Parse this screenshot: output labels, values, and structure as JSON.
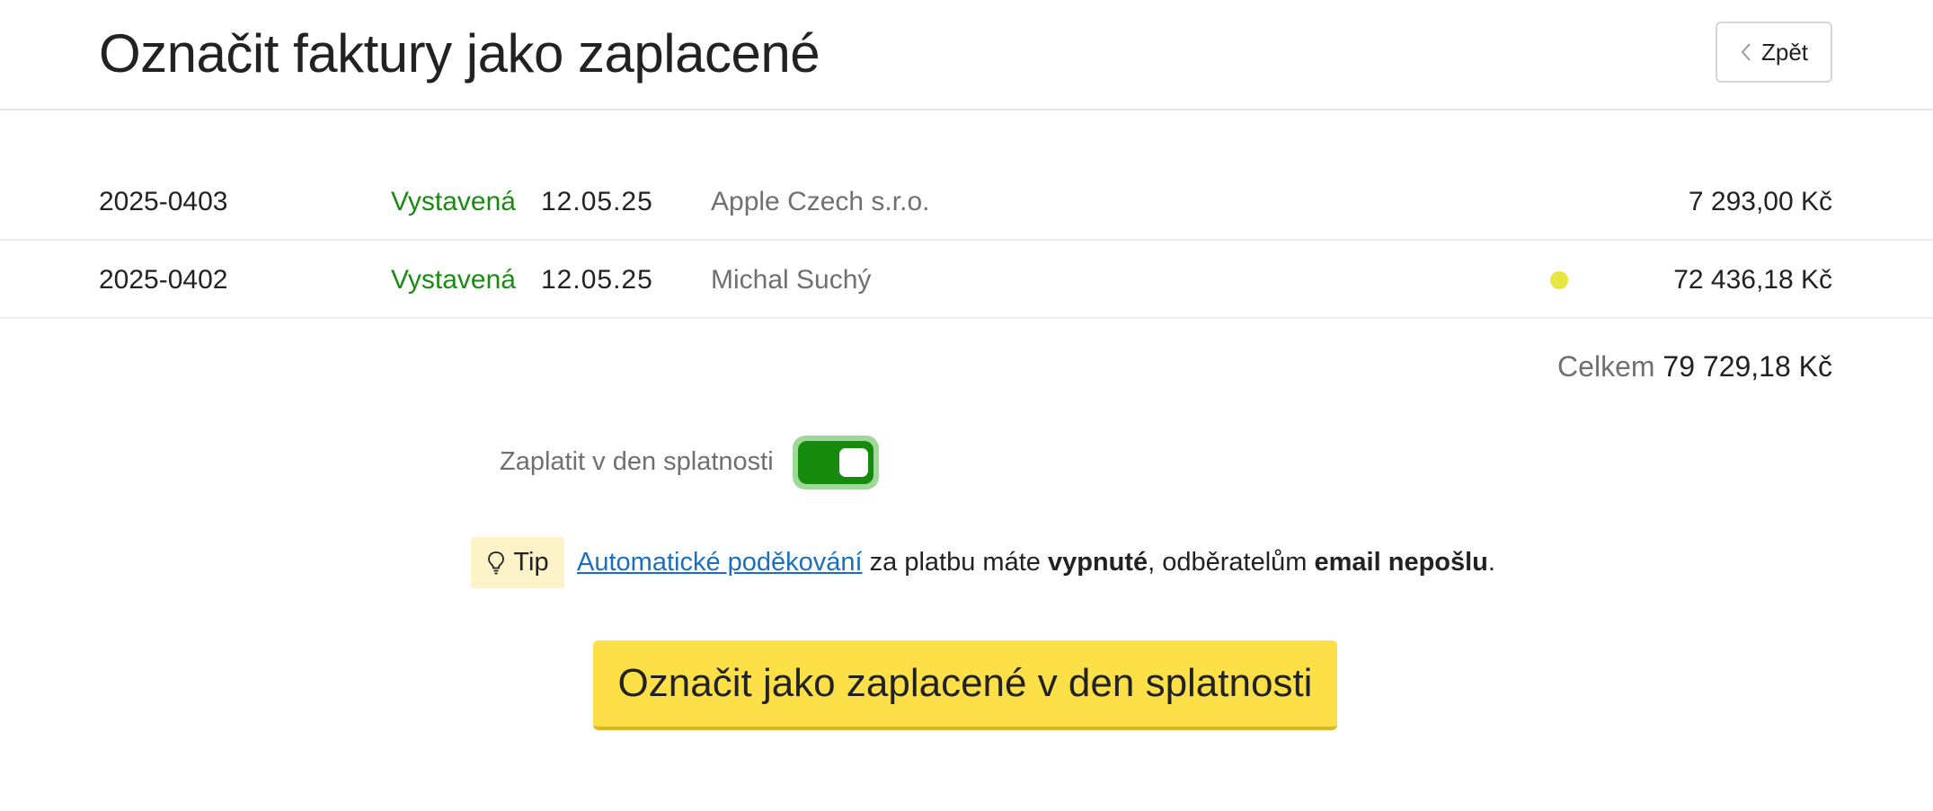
{
  "header": {
    "title": "Označit faktury jako zaplacené",
    "back_label": "Zpět"
  },
  "invoices": [
    {
      "number": "2025-0403",
      "status": "Vystavená",
      "date": "12.05.25",
      "client": "Apple Czech s.r.o.",
      "amount": "7 293,00 Kč",
      "flag": false
    },
    {
      "number": "2025-0402",
      "status": "Vystavená",
      "date": "12.05.25",
      "client": "Michal Suchý",
      "amount": "72 436,18 Kč",
      "flag": true
    }
  ],
  "summary": {
    "total_label": "Celkem",
    "total_value": "79 729,18 Kč"
  },
  "toggle": {
    "label": "Zaplatit v den splatnosti",
    "on": true
  },
  "tip": {
    "badge": "Tip",
    "link": "Automatické poděkování",
    "text_1": " za platbu máte ",
    "bold_1": "vypnuté",
    "text_2": ", odběratelům ",
    "bold_2": "email nepošlu",
    "text_3": "."
  },
  "action": {
    "submit_label": "Označit jako zaplacené v den splatnosti"
  },
  "colors": {
    "status_green": "#1a8a12",
    "toggle_on": "#168a0c",
    "button_yellow": "#fddf47",
    "tip_bg": "#fdf3c8",
    "link_blue": "#1a6fbf",
    "flag_yellow": "#e8e640"
  },
  "icons": {
    "back": "chevron-left-icon",
    "tip": "lightbulb-icon",
    "flag": "status-dot-icon"
  }
}
